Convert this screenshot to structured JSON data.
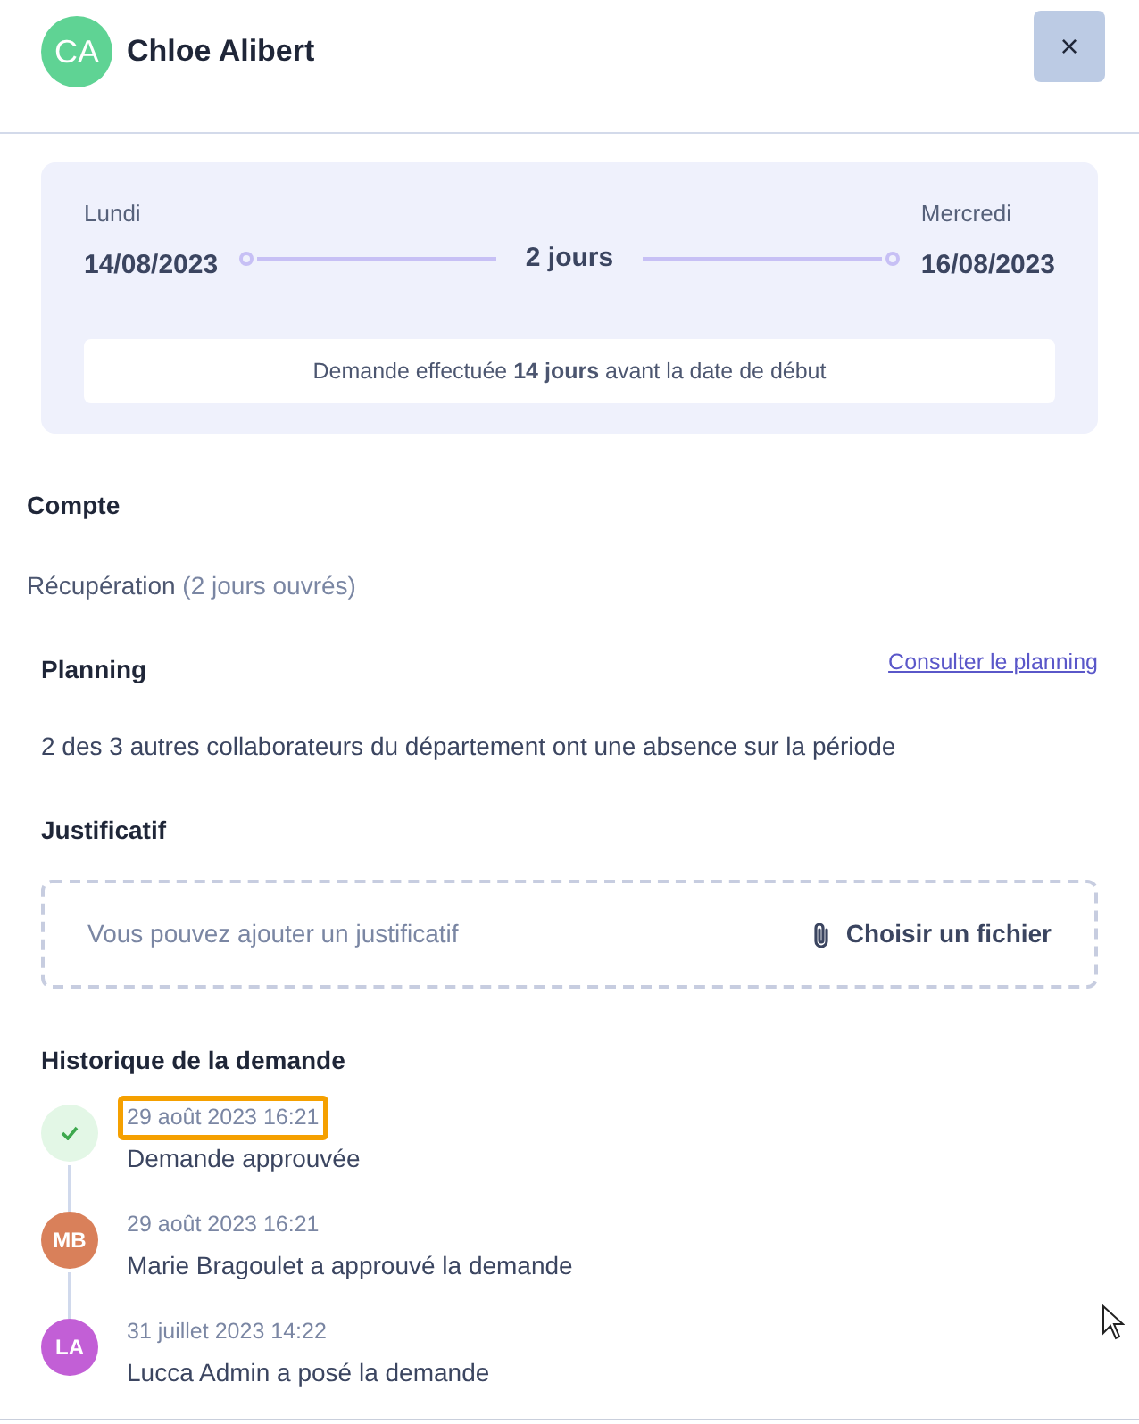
{
  "header": {
    "avatar": {
      "initials": "CA",
      "color": "#5fd394"
    },
    "name": "Chloe Alibert",
    "close": "×"
  },
  "period": {
    "start_day": "Lundi",
    "start_date": "14/08/2023",
    "duration": "2 jours",
    "end_day": "Mercredi",
    "end_date": "16/08/2023",
    "note": "Demande effectuée **14 jours** avant la date de début"
  },
  "account": {
    "title": "Compte",
    "value": "Récupération",
    "detail": "(2 jours ouvrés)"
  },
  "planning": {
    "title": "Planning",
    "link": "Consulter le planning",
    "text": "2 des 3 autres collaborateurs du département ont une absence sur la période"
  },
  "attachment": {
    "title": "Justificatif",
    "placeholder": "Vous pouvez ajouter un justificatif",
    "button": "Choisir un fichier"
  },
  "history": {
    "title": "Historique de la demande",
    "items": [
      {
        "kind": "status",
        "date": "29 août 2023 16:21",
        "text": "Demande approuvée",
        "highlighted": true
      },
      {
        "kind": "avatar",
        "initials": "MB",
        "color": "#d9805a",
        "date": "29 août 2023 16:21",
        "text": "Marie Bragoulet a approuvé la demande",
        "highlighted": false
      },
      {
        "kind": "avatar",
        "initials": "LA",
        "color": "#c25fd6",
        "date": "31 juillet 2023 14:22",
        "text": "Lucca Admin a posé la demande",
        "highlighted": false
      }
    ]
  }
}
